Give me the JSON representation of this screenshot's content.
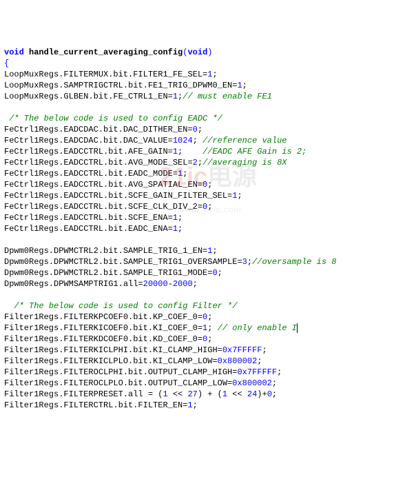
{
  "fn_name": "handle_current_averaging_config",
  "line1_a": "LoopMuxRegs.FILTERMUX.bit.FILTER1_FE_SEL=",
  "line1_n": "1",
  "line2_a": "LoopMuxRegs.SAMPTRIGCTRL.bit.FE1_TRIG_DPWM0_EN=",
  "line2_n": "1",
  "line3_a": "LoopMuxRegs.GLBEN.bit.FE_CTRL1_EN=",
  "line3_n": "1",
  "line3_c": "// must enable FE1",
  "sec1_c": "/* The below code is used to config EADC */",
  "f1_a": "FeCtrl1Regs.EADCDAC.bit.DAC_DITHER_EN=",
  "f1_n": "0",
  "f2_a": "FeCtrl1Regs.EADCDAC.bit.DAC_VALUE=",
  "f2_n": "1024",
  "f2_c": "//reference value",
  "f3_a": "FeCtrl1Regs.EADCCTRL.bit.AFE_GAIN=",
  "f3_n": "1",
  "f3_c": "//EADC AFE Gain is 2;",
  "f4_a": "FeCtrl1Regs.EADCCTRL.bit.AVG_MODE_SEL=",
  "f4_n": "2",
  "f4_c": "//averaging is 8X",
  "f5_a": "FeCtrl1Regs.EADCCTRL.bit.EADC_MODE=",
  "f5_n": "1",
  "f6_a": "FeCtrl1Regs.EADCCTRL.bit.AVG_SPATIAL_EN=",
  "f6_n": "0",
  "f7_a": "FeCtrl1Regs.EADCCTRL.bit.SCFE_GAIN_FILTER_SEL=",
  "f7_n": "1",
  "f8_a": "FeCtrl1Regs.EADCCTRL.bit.SCFE_CLK_DIV_2=",
  "f8_n": "0",
  "f9_a": "FeCtrl1Regs.EADCCTRL.bit.SCFE_ENA=",
  "f9_n": "1",
  "f10_a": "FeCtrl1Regs.EADCCTRL.bit.EADC_ENA=",
  "f10_n": "1",
  "d1_a": "Dpwm0Regs.DPWMCTRL2.bit.SAMPLE_TRIG_1_EN=",
  "d1_n": "1",
  "d2_a": "Dpwm0Regs.DPWMCTRL2.bit.SAMPLE_TRIG1_OVERSAMPLE=",
  "d2_n": "3",
  "d2_c": "//oversample is 8",
  "d3_a": "Dpwm0Regs.DPWMCTRL2.bit.SAMPLE_TRIG1_MODE=",
  "d3_n": "0",
  "d4_a": "Dpwm0Regs.DPWMSAMPTRIG1.all=",
  "d4_n1": "20000",
  "d4_n2": "2000",
  "sec2_c": "/* The below code is used to config Filter */",
  "p1_a": "Filter1Regs.FILTERKPCOEF0.bit.KP_COEF_0=",
  "p1_n": "0",
  "p2_a": "Filter1Regs.FILTERKICOEF0.bit.KI_COEF_0=",
  "p2_n": "1",
  "p2_c": "// only enable I",
  "p3_a": "Filter1Regs.FILTERKDCOEF0.bit.KD_COEF_0=",
  "p3_n": "0",
  "p4_a": "Filter1Regs.FILTERKICLPHI.bit.KI_CLAMP_HIGH=",
  "p4_n": "0x7FFFFF",
  "p5_a": "Filter1Regs.FILTERKICLPLO.bit.KI_CLAMP_LOW=",
  "p5_n": "0x800002",
  "p6_a": "Filter1Regs.FILTEROCLPHI.bit.OUTPUT_CLAMP_HIGH=",
  "p6_n": "0x7FFFFF",
  "p7_a": "Filter1Regs.FILTEROCLPLO.bit.OUTPUT_CLAMP_LOW=",
  "p7_n": "0x800002",
  "p8_a": "Filter1Regs.FILTERPRESET.all = (",
  "p8_n1": "1",
  "p8_n2": "27",
  "p8_n3": "1",
  "p8_n4": "24",
  "p8_n5": "0",
  "p9_a": "Filter1Regs.FILTERCTRL.bit.FILTER_EN=",
  "p9_n": "1",
  "wm_red": "21ic",
  "wm_gray": "电源",
  "wm_sub": "power.21ic.com"
}
